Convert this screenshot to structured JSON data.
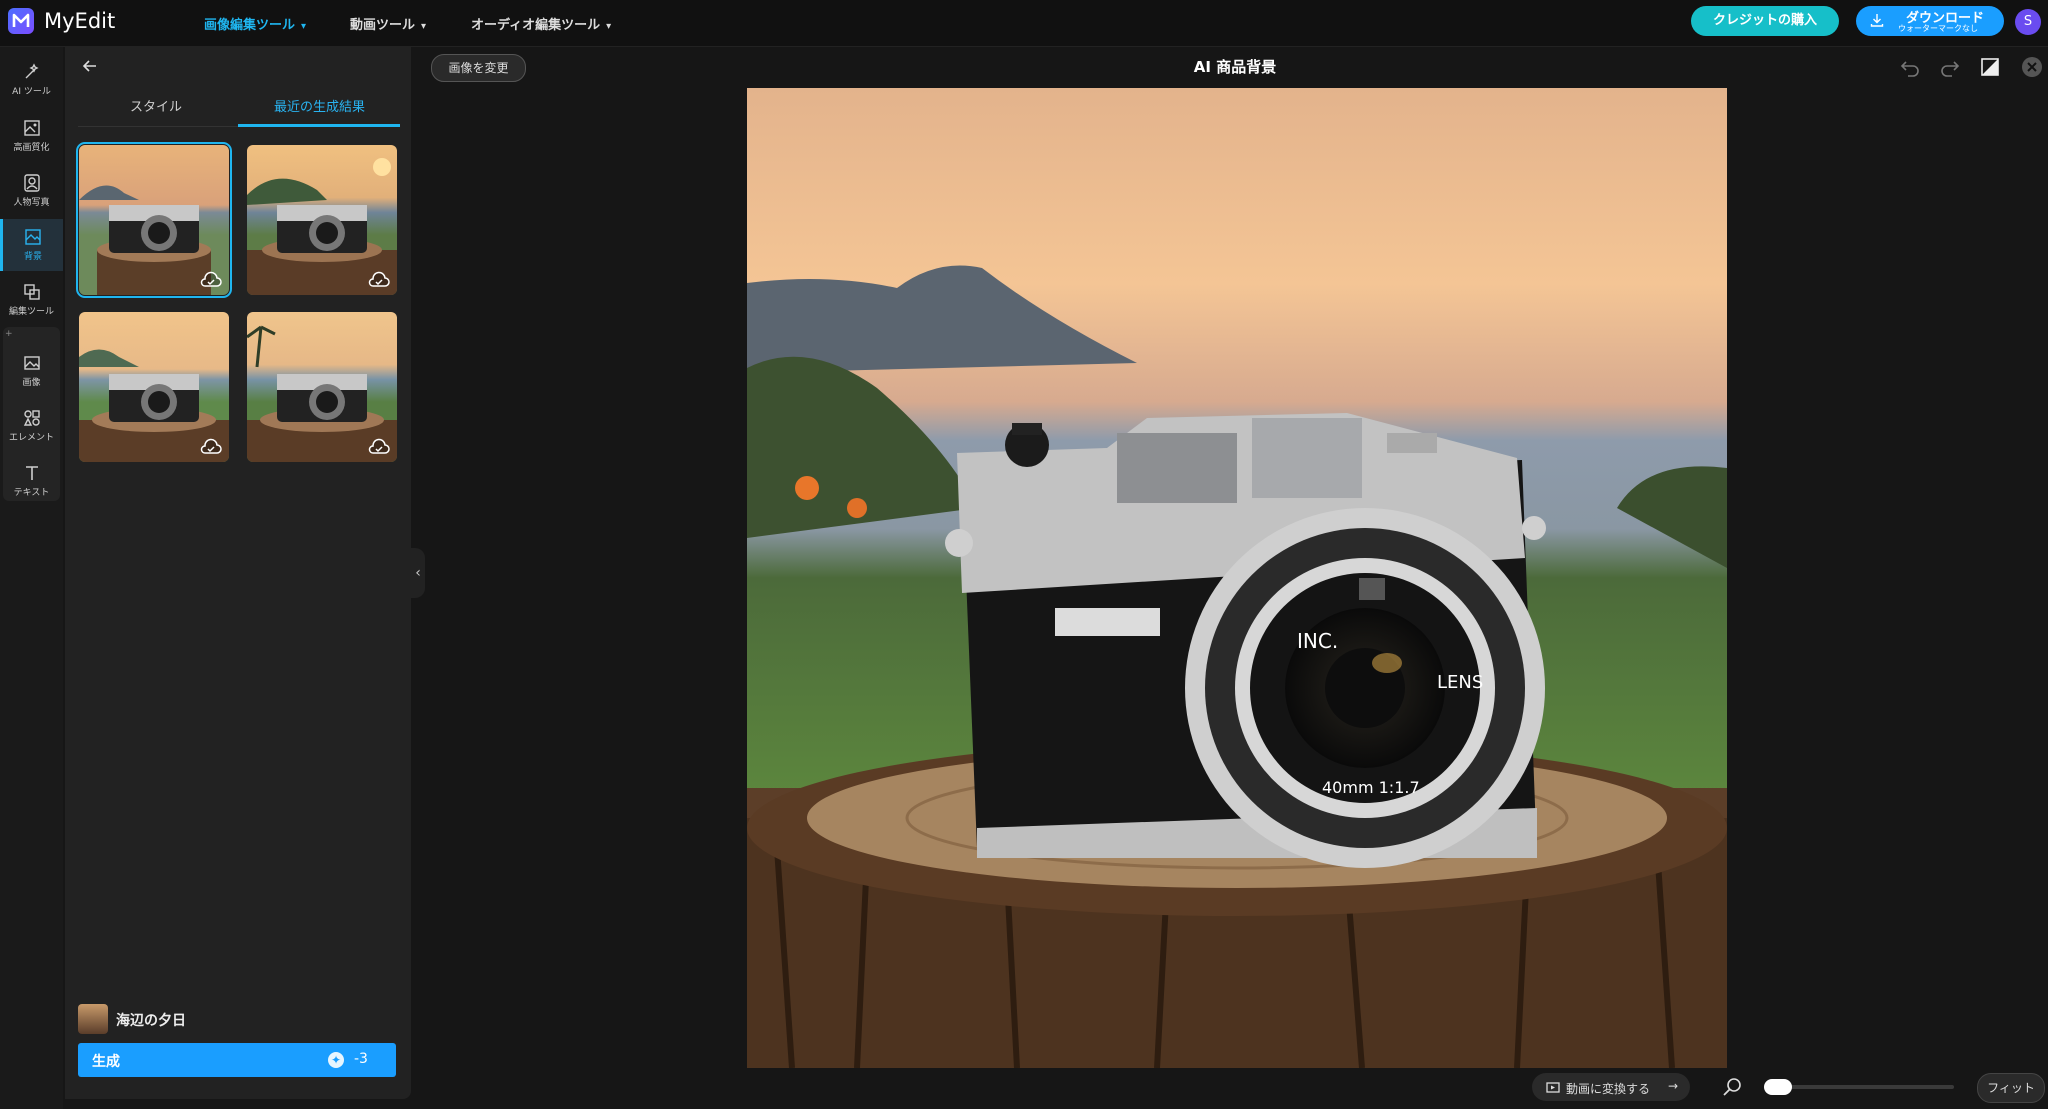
{
  "app": {
    "name": "MyEdit"
  },
  "topnav": {
    "items": [
      {
        "label": "画像編集ツール"
      },
      {
        "label": "動画ツール"
      },
      {
        "label": "オーディオ編集ツール"
      }
    ],
    "credit_button": "クレジットの購入",
    "download_button": {
      "main": "ダウンロード",
      "sub": "ウォーターマークなし"
    },
    "avatar_initial": "S"
  },
  "rail": {
    "items": [
      {
        "label": "AI ツール",
        "icon": "magic-wand-icon"
      },
      {
        "label": "高画質化",
        "icon": "enhance-image-icon"
      },
      {
        "label": "人物写真",
        "icon": "portrait-icon"
      },
      {
        "label": "背景",
        "icon": "background-icon",
        "active": true
      },
      {
        "label": "編集ツール",
        "icon": "crop-tools-icon"
      },
      {
        "label": "画像",
        "icon": "image-icon"
      },
      {
        "label": "エレメント",
        "icon": "elements-icon"
      },
      {
        "label": "テキスト",
        "icon": "text-icon"
      }
    ]
  },
  "panel": {
    "tabs": [
      {
        "label": "スタイル"
      },
      {
        "label": "最近の生成結果",
        "active": true
      }
    ],
    "results_count": 4,
    "selected_result": 1,
    "preset": {
      "name": "海辺の夕日"
    },
    "generate": {
      "label": "生成",
      "cost": "-3"
    }
  },
  "canvas": {
    "change_image_button": "画像を変更",
    "title": "AI 商品背景",
    "image_subject": "vintage rangefinder camera on tree stump at seaside sunset",
    "lens_text_1": "INC.",
    "lens_text_2": "LENS",
    "lens_text_3": "40mm 1:1.7"
  },
  "bottombar": {
    "convert_video_button": "動画に変換する",
    "fit_button": "フィット",
    "zoom_level": 0
  },
  "colors": {
    "accent": "#1fb6f0",
    "credit": "#16bfc9",
    "download": "#1a9eff"
  }
}
